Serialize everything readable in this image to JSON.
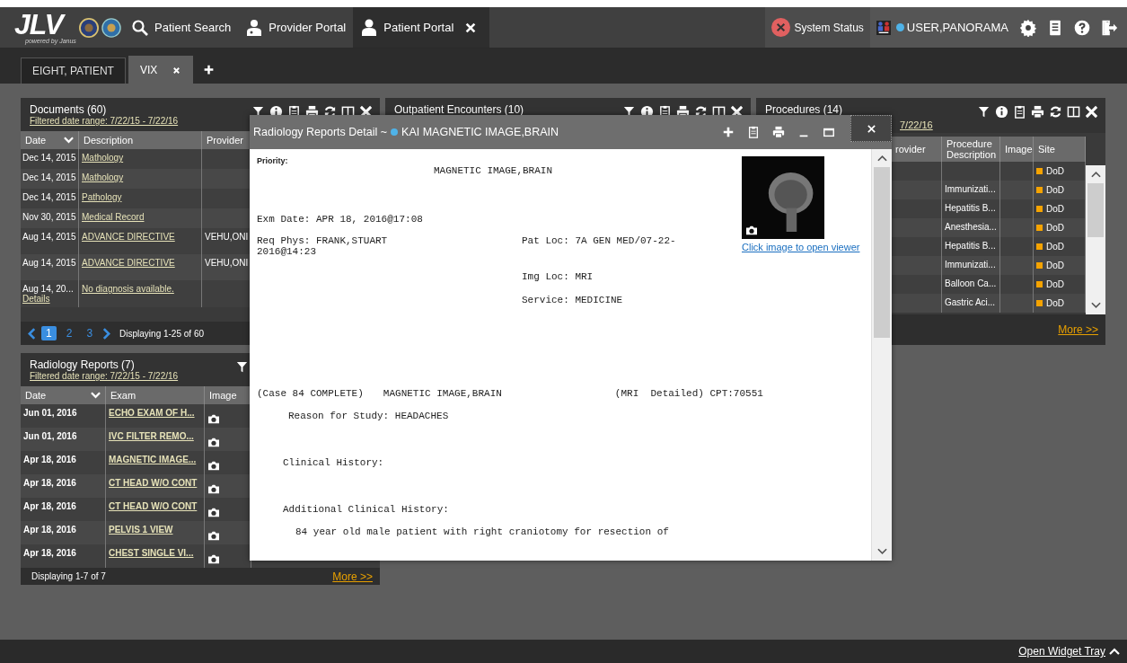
{
  "app_header": {
    "logo": "JLV",
    "logo_tagline": "powered by Janus",
    "nav": [
      {
        "label": "Patient Search",
        "kind": "search",
        "selected": false,
        "closable": false
      },
      {
        "label": "Provider Portal",
        "kind": "provider",
        "selected": false,
        "closable": false
      },
      {
        "label": "Patient Portal",
        "kind": "patient",
        "selected": true,
        "closable": true
      }
    ],
    "system_status": "System Status",
    "user": "USER,PANORAMA"
  },
  "patient_tabs": [
    {
      "label": "EIGHT, PATIENT",
      "selected": false,
      "closable": false
    },
    {
      "label": "VIX",
      "selected": true,
      "closable": true
    }
  ],
  "documents_widget": {
    "title": "Documents (60)",
    "filter": "Filtered date range: 7/22/15 - 7/22/16",
    "columns": [
      "Date",
      "Description",
      "Provider"
    ],
    "rows": [
      {
        "date": "Dec 14, 2015",
        "description": "Mathology"
      },
      {
        "date": "Dec 14, 2015",
        "description": "Mathology"
      },
      {
        "date": "Dec 14, 2015",
        "description": "Pathology"
      },
      {
        "date": "Nov 30, 2015",
        "description": "Medical Record"
      },
      {
        "date": "Aug 14, 2015",
        "description": "ADVANCE DIRECTIVE",
        "provider": "VEHU,ONI"
      },
      {
        "date": "Aug 14, 2015",
        "description": "ADVANCE DIRECTIVE",
        "provider": "VEHU,ONI"
      },
      {
        "date": "Aug 14, 20...",
        "details": "Details",
        "description": "No diagnosis available."
      }
    ],
    "pager": [
      {
        "label": "1",
        "selected": true
      },
      {
        "label": "2",
        "selected": false
      },
      {
        "label": "3",
        "selected": false
      }
    ],
    "status": "Displaying 1-25 of 60"
  },
  "outpatient_widget": {
    "title": "Outpatient Encounters (10)"
  },
  "procedures_widget": {
    "title": "Procedures (14)",
    "filter": "7/22/16",
    "columns": [
      "rovider",
      "Procedure Description",
      "Image",
      "Site"
    ],
    "rows": [
      {
        "site": "DoD"
      },
      {
        "description": "Immunizati...",
        "site": "DoD"
      },
      {
        "description": "Hepatitis B...",
        "site": "DoD"
      },
      {
        "description": "Anesthesia...",
        "site": "DoD"
      },
      {
        "description": "Hepatitis B...",
        "site": "DoD"
      },
      {
        "description": "Immunizati...",
        "site": "DoD"
      },
      {
        "description": "Balloon Ca...",
        "site": "DoD"
      },
      {
        "description": "Gastric Aci...",
        "site": "DoD"
      }
    ],
    "more": "More >>"
  },
  "radiology_widget": {
    "title": "Radiology Reports (7)",
    "filter": "Filtered date range: 7/22/15 - 7/22/16",
    "columns": [
      "Date",
      "Exam",
      "Image"
    ],
    "rows": [
      {
        "date": "Jun 01, 2016",
        "exam": "ECHO EXAM OF H..."
      },
      {
        "date": "Jun 01, 2016",
        "exam": "IVC FILTER REMO..."
      },
      {
        "date": "Apr 18, 2016",
        "exam": "MAGNETIC IMAGE..."
      },
      {
        "date": "Apr 18, 2016",
        "exam": "CT HEAD W/O CONT"
      },
      {
        "date": "Apr 18, 2016",
        "exam": "CT HEAD W/O CONT"
      },
      {
        "date": "Apr 18, 2016",
        "exam": "PELVIS 1 VIEW"
      },
      {
        "date": "Apr 18, 2016",
        "exam": "CHEST SINGLE VI..."
      }
    ],
    "status": "Displaying 1-7 of 7",
    "more": "More >>"
  },
  "detail_window": {
    "title": "Radiology Reports Detail ~",
    "patient": "KAI MAGNETIC IMAGE,BRAIN",
    "priority_label": "Priority:",
    "report_title": "MAGNETIC IMAGE,BRAIN",
    "exam_date": "Exm Date: APR 18, 2016@17:08",
    "req_phys": "Req Phys: FRANK,STUART",
    "pat_loc": "Pat Loc: 7A GEN MED/07-22-",
    "pat_loc_cont": "2016@14:23",
    "img_loc": "Img Loc: MRI",
    "service": "Service: MEDICINE",
    "case": "(Case 84 COMPLETE)",
    "case_exam": "MAGNETIC IMAGE,BRAIN",
    "case_cpt": "(MRI  Detailed) CPT:70551",
    "reason": "Reason for Study: HEADACHES",
    "clinical_history": "Clinical History:",
    "additional_history": "Additional Clinical History:",
    "history_text": "84 year old male patient with right craniotomy for resection of",
    "viewer_link": "Click image to open viewer"
  },
  "footer": {
    "widget_tray": "Open Widget Tray"
  }
}
